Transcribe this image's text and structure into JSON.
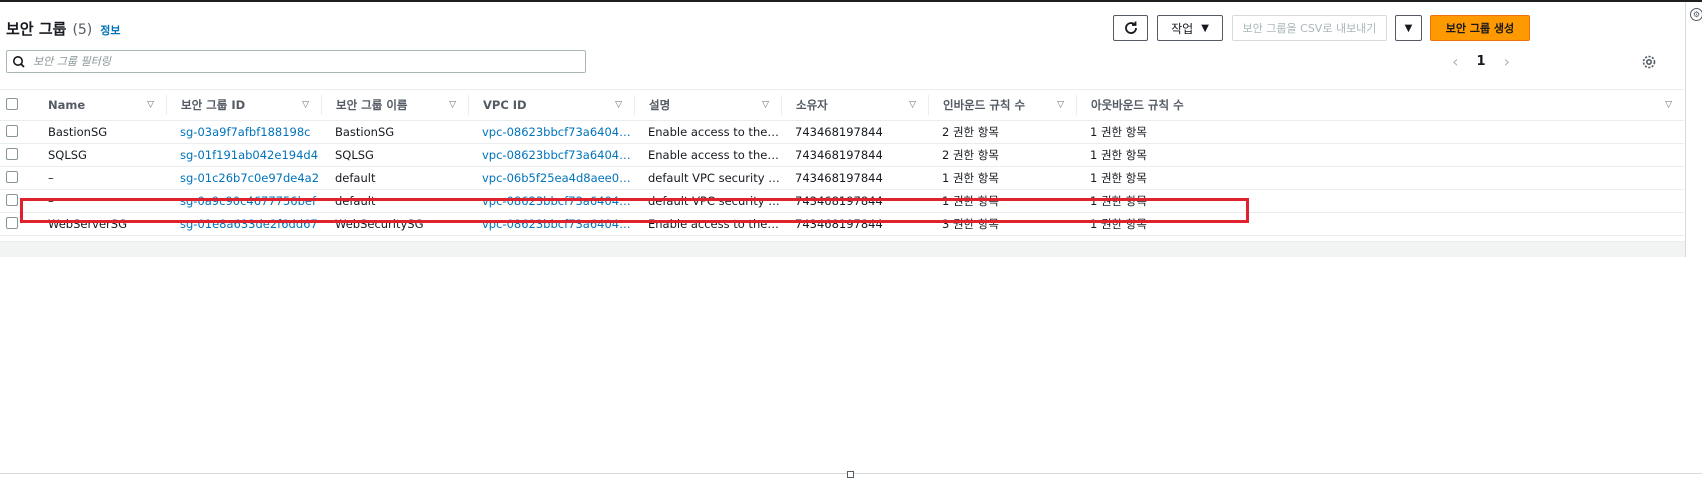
{
  "header": {
    "title": "보안 그룹",
    "count": "(5)",
    "info": "정보"
  },
  "toolbar": {
    "refresh_label": "↻",
    "actions_label": "작업",
    "export_label": "보안 그룹을 CSV로 내보내기",
    "create_label": "보안 그룹 생성"
  },
  "search": {
    "placeholder": "보안 그룹 필터링"
  },
  "pagination": {
    "page": "1",
    "prev": "‹",
    "next": "›"
  },
  "table": {
    "columns": [
      "Name",
      "보안 그룹 ID",
      "보안 그룹 이름",
      "VPC ID",
      "설명",
      "소유자",
      "인바운드 규칙 수",
      "아웃바운드 규칙 수"
    ],
    "rows": [
      {
        "name": "BastionSG",
        "sg_id": "sg-03a9f7afbf188198c",
        "sg_name": "BastionSG",
        "vpc_id": "vpc-08623bbcf73a64049",
        "desc": "Enable access to the B...",
        "owner": "743468197844",
        "inbound": "2 권한 항목",
        "outbound": "1 권한 항목"
      },
      {
        "name": "SQLSG",
        "sg_id": "sg-01f191ab042e194d4",
        "sg_name": "SQLSG",
        "vpc_id": "vpc-08623bbcf73a64049",
        "desc": "Enable access to the B...",
        "owner": "743468197844",
        "inbound": "2 권한 항목",
        "outbound": "1 권한 항목"
      },
      {
        "name": "–",
        "sg_id": "sg-01c26b7c0e97de4a2",
        "sg_name": "default",
        "vpc_id": "vpc-06b5f25ea4d8aee08",
        "desc": "default VPC security gr...",
        "owner": "743468197844",
        "inbound": "1 권한 항목",
        "outbound": "1 권한 항목"
      },
      {
        "name": "–",
        "sg_id": "sg-0a9c90c4677756bef",
        "sg_name": "default",
        "vpc_id": "vpc-08623bbcf73a64049",
        "desc": "default VPC security gr...",
        "owner": "743468197844",
        "inbound": "1 권한 항목",
        "outbound": "1 권한 항목"
      },
      {
        "name": "WebServerSG",
        "sg_id": "sg-01e8a633de2f6dd67",
        "sg_name": "WebSecuritySG",
        "vpc_id": "vpc-08623bbcf73a64049",
        "desc": "Enable access to the W...",
        "owner": "743468197844",
        "inbound": "3 권한 항목",
        "outbound": "1 권한 항목"
      }
    ]
  },
  "colors": {
    "link": "#0073bb",
    "primary": "#ff9900",
    "highlight": "#e0212e"
  }
}
